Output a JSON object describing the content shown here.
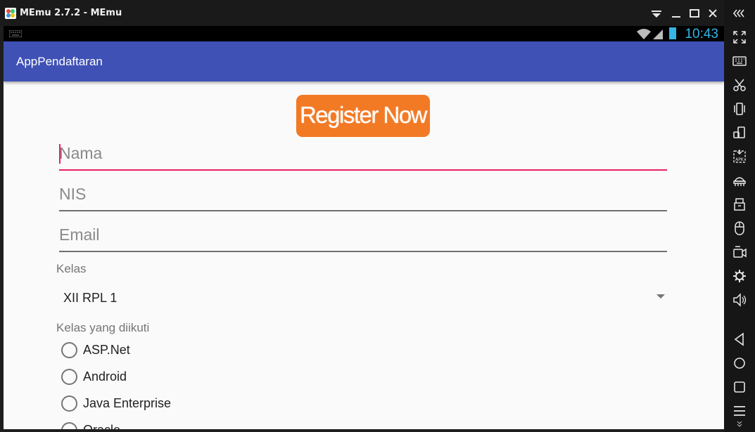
{
  "window": {
    "title": "MEmu 2.7.2 - MEmu"
  },
  "statusbar": {
    "time": "10:43"
  },
  "app": {
    "title": "AppPendaftaran",
    "register_label": "Register Now",
    "fields": {
      "nama_placeholder": "Nama",
      "nis_placeholder": "NIS",
      "email_placeholder": "Email"
    },
    "kelas_label": "Kelas",
    "kelas_selected": "XII RPL 1",
    "course_label": "Kelas yang diikuti",
    "courses": [
      "ASP.Net",
      "Android",
      "Java Enterprise",
      "Oracle"
    ]
  },
  "colors": {
    "actionbar": "#3f51b5",
    "accent": "#e91e63",
    "register_button": "#f27a25",
    "status_icons": "#33b5e5"
  },
  "toolbar_icons": [
    "collapse-icon",
    "fullscreen-icon",
    "keyboard-icon",
    "screenshot-icon",
    "shake-icon",
    "rotate-icon",
    "apk-install-icon",
    "android-icon",
    "usb-icon",
    "mouse-icon",
    "record-icon",
    "settings-icon",
    "volume-icon",
    "back-icon",
    "home-icon",
    "recents-icon",
    "menu-icon"
  ]
}
